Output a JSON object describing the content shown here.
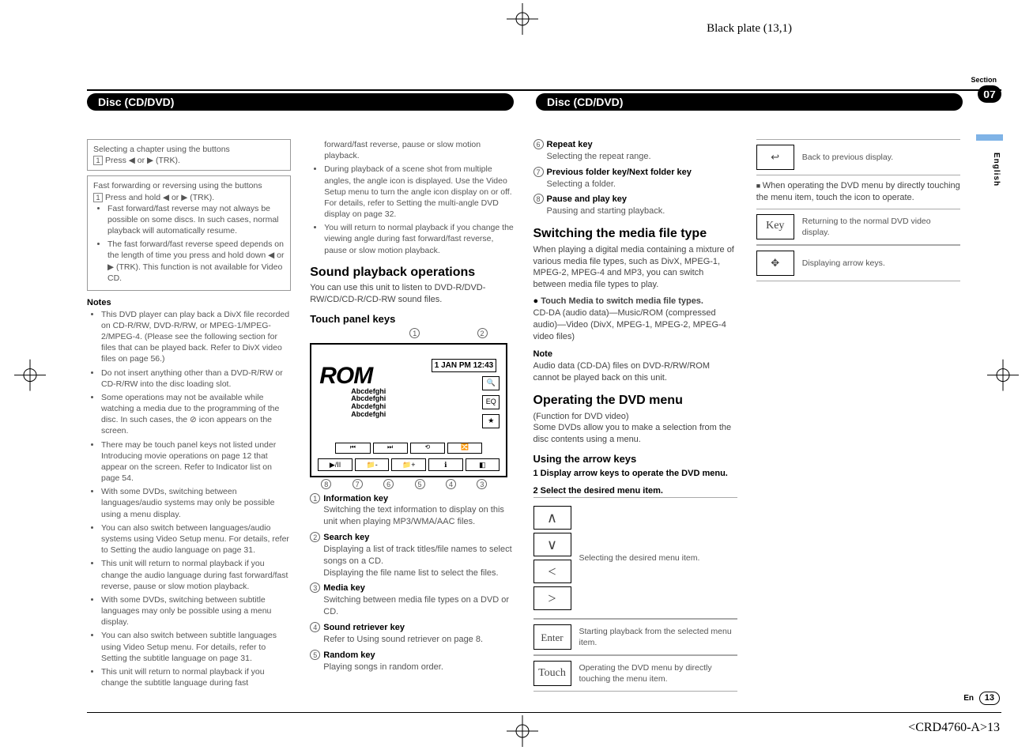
{
  "plate": "Black plate (13,1)",
  "sectionWord": "Section",
  "sectionNum": "07",
  "langTab": "English",
  "headerLeft": "Disc (CD/DVD)",
  "headerRight": "Disc (CD/DVD)",
  "footer": {
    "doc": "<CRD4760-A>13",
    "en": "En",
    "page": "13"
  },
  "box1": {
    "title": "Selecting a chapter using the buttons",
    "step": "Press ◀ or ▶ (TRK)."
  },
  "box2": {
    "title": "Fast forwarding or reversing using the buttons",
    "step": "Press and hold ◀ or ▶ (TRK).",
    "b1": "Fast forward/fast reverse may not always be possible on some discs. In such cases, normal playback will automatically resume.",
    "b2": "The fast forward/fast reverse speed depends on the length of time you press and hold down ◀ or ▶ (TRK). This function is not available for Video CD."
  },
  "notesHeading": "Notes",
  "notes": [
    "This DVD player can play back a DivX file recorded on CD-R/RW, DVD-R/RW, or MPEG-1/MPEG-2/MPEG-4. (Please see the following section for files that can be played back. Refer to DivX video files on page 56.)",
    "Do not insert anything other than a DVD-R/RW or CD-R/RW into the disc loading slot.",
    "Some operations may not be available while watching a media due to the programming of the disc. In such cases, the ⊘ icon appears on the screen.",
    "There may be touch panel keys not listed under Introducing movie operations on page 12 that appear on the screen. Refer to Indicator list on page 54.",
    "With some DVDs, switching between languages/audio systems may only be possible using a menu display.",
    "You can also switch between languages/audio systems using Video Setup menu. For details, refer to Setting the audio language on page 31.",
    "This unit will return to normal playback if you change the audio language during fast forward/fast reverse, pause or slow motion playback.",
    "With some DVDs, switching between subtitle languages may only be possible using a menu display.",
    "You can also switch between subtitle languages using Video Setup menu. For details, refer to Setting the subtitle language on page 31.",
    "This unit will return to normal playback if you change the subtitle language during fast forward/fast reverse, pause or slow motion playback.",
    "During playback of a scene shot from multiple angles, the angle icon is displayed. Use the Video Setup menu to turn the angle icon display on or off. For details, refer to Setting the multi-angle DVD display on page 32.",
    "You will return to normal playback if you change the viewing angle during fast forward/fast reverse, pause or slow motion playback."
  ],
  "soundH": "Sound playback operations",
  "soundP": "You can use this unit to listen to DVD-R/DVD-RW/CD/CD-R/CD-RW sound files.",
  "touchH": "Touch panel keys",
  "diagram": {
    "rom": "ROM",
    "lines": "Abcdefghi\nAbcdefghi\nAbcdefghi\nAbcdefghi",
    "clock": "1 JAN PM 12:43",
    "eq": "EQ",
    "star": "★",
    "callTop": [
      "1",
      "2"
    ],
    "callBot": [
      "8",
      "7",
      "6",
      "5",
      "4",
      "3"
    ]
  },
  "infoKey": {
    "label": "Information key",
    "desc": "Switching the text information to display on this unit when playing MP3/WMA/AAC files."
  },
  "keys": [
    {
      "n": "2",
      "label": "Search key",
      "desc": "Displaying a list of track titles/file names to select songs on a CD.\nDisplaying the file name list to select the files."
    },
    {
      "n": "3",
      "label": "Media key",
      "desc": "Switching between media file types on a DVD or CD."
    },
    {
      "n": "4",
      "label": "Sound retriever key",
      "desc": "Refer to Using sound retriever on page 8."
    },
    {
      "n": "5",
      "label": "Random key",
      "desc": "Playing songs in random order."
    },
    {
      "n": "6",
      "label": "Repeat key",
      "desc": "Selecting the repeat range."
    },
    {
      "n": "7",
      "label": "Previous folder key/Next folder key",
      "desc": "Selecting a folder."
    },
    {
      "n": "8",
      "label": "Pause and play key",
      "desc": "Pausing and starting playback."
    }
  ],
  "switchH": "Switching the media file type",
  "switchP": "When playing a digital media containing a mixture of various media file types, such as DivX, MPEG-1, MPEG-2, MPEG-4 and MP3, you can switch between media file types to play.",
  "switchBullet": "Touch Media to switch media file types.",
  "switchList": "CD-DA (audio data)—Music/ROM (compressed audio)—Video (DivX, MPEG-1, MPEG-2, MPEG-4 video files)",
  "switchNoteH": "Note",
  "switchNote": "Audio data (CD-DA) files on DVD-R/RW/ROM cannot be played back on this unit.",
  "opH": "Operating the DVD menu",
  "opSub": "(Function for DVD video)",
  "opP": "Some DVDs allow you to make a selection from the disc contents using a menu.",
  "arrowH": "Using the arrow keys",
  "arrowStep1": "1   Display arrow keys to operate the DVD menu.",
  "arrowStep2": "2   Select the desired menu item.",
  "arrowDesc": "Selecting the desired menu item.",
  "rows": [
    {
      "key": "Enter",
      "desc": "Starting playback from the selected menu item."
    },
    {
      "key": "Touch",
      "desc": "Operating the DVD menu by directly touching the menu item."
    },
    {
      "key": "↩",
      "desc": "Back to previous display."
    }
  ],
  "opNote": "When operating the DVD menu by directly touching the menu item, touch the icon to operate.",
  "rows2": [
    {
      "key": "Key",
      "desc": "Returning to the normal DVD video display."
    },
    {
      "key": "✥",
      "desc": "Displaying arrow keys."
    }
  ]
}
